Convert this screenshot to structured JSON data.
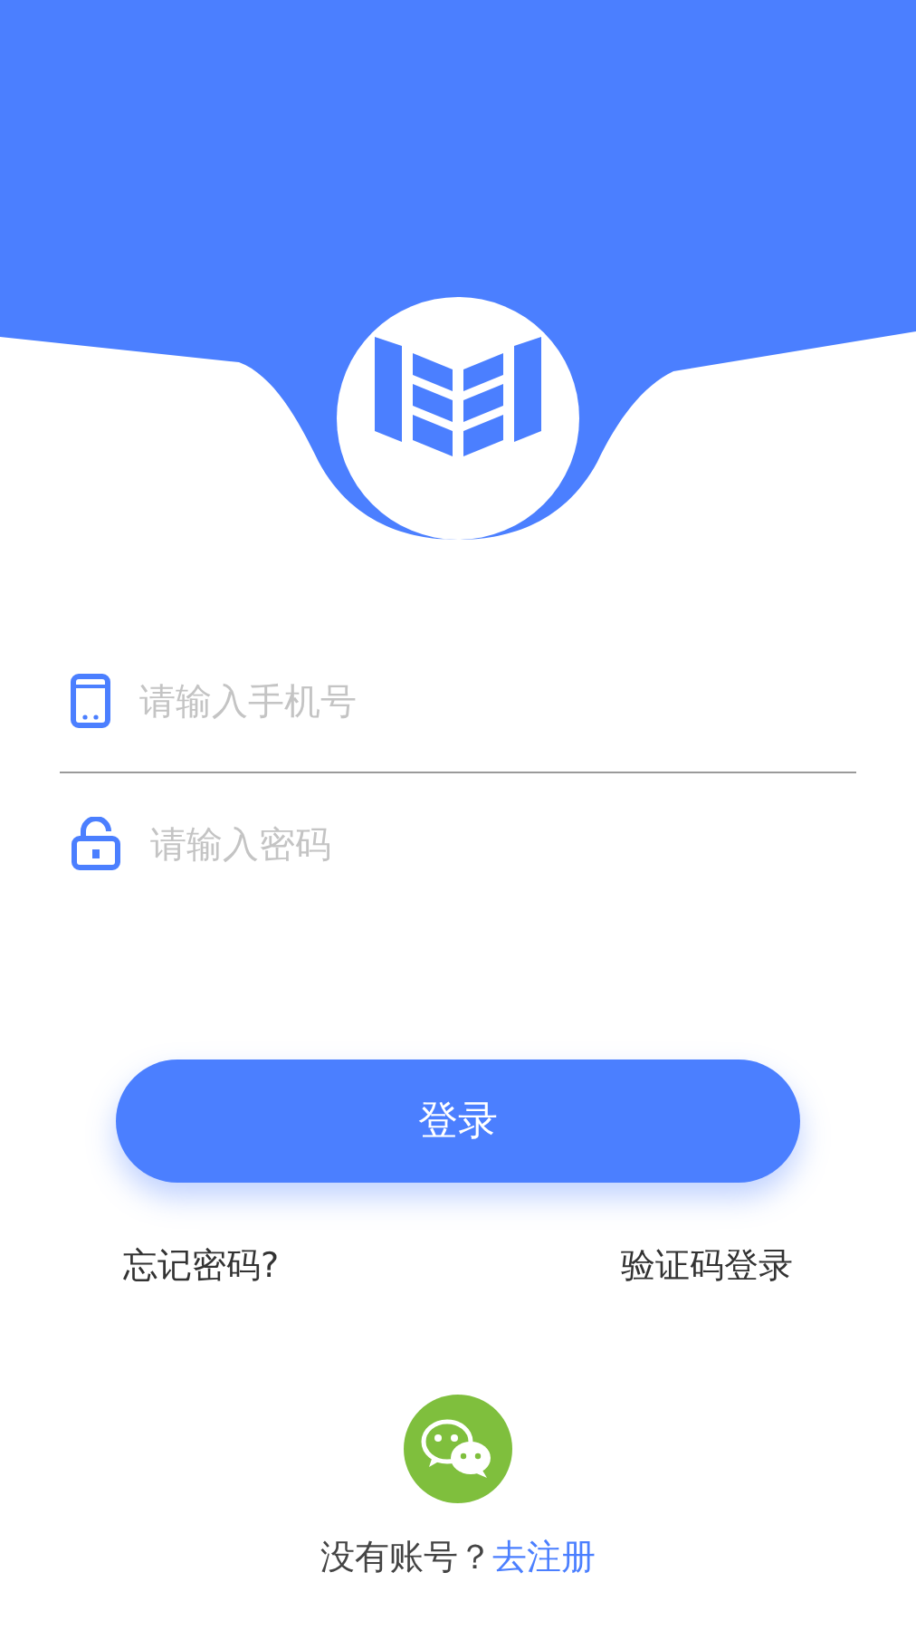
{
  "login_form": {
    "phone_field": {
      "placeholder": "请输入手机号"
    },
    "password_field": {
      "placeholder": "请输入密码"
    },
    "login_button": "登录"
  },
  "links": {
    "forgot_password": "忘记密码?",
    "sms_login": "验证码登录"
  },
  "footer": {
    "question": "没有账号？",
    "register_link": "去注册"
  }
}
